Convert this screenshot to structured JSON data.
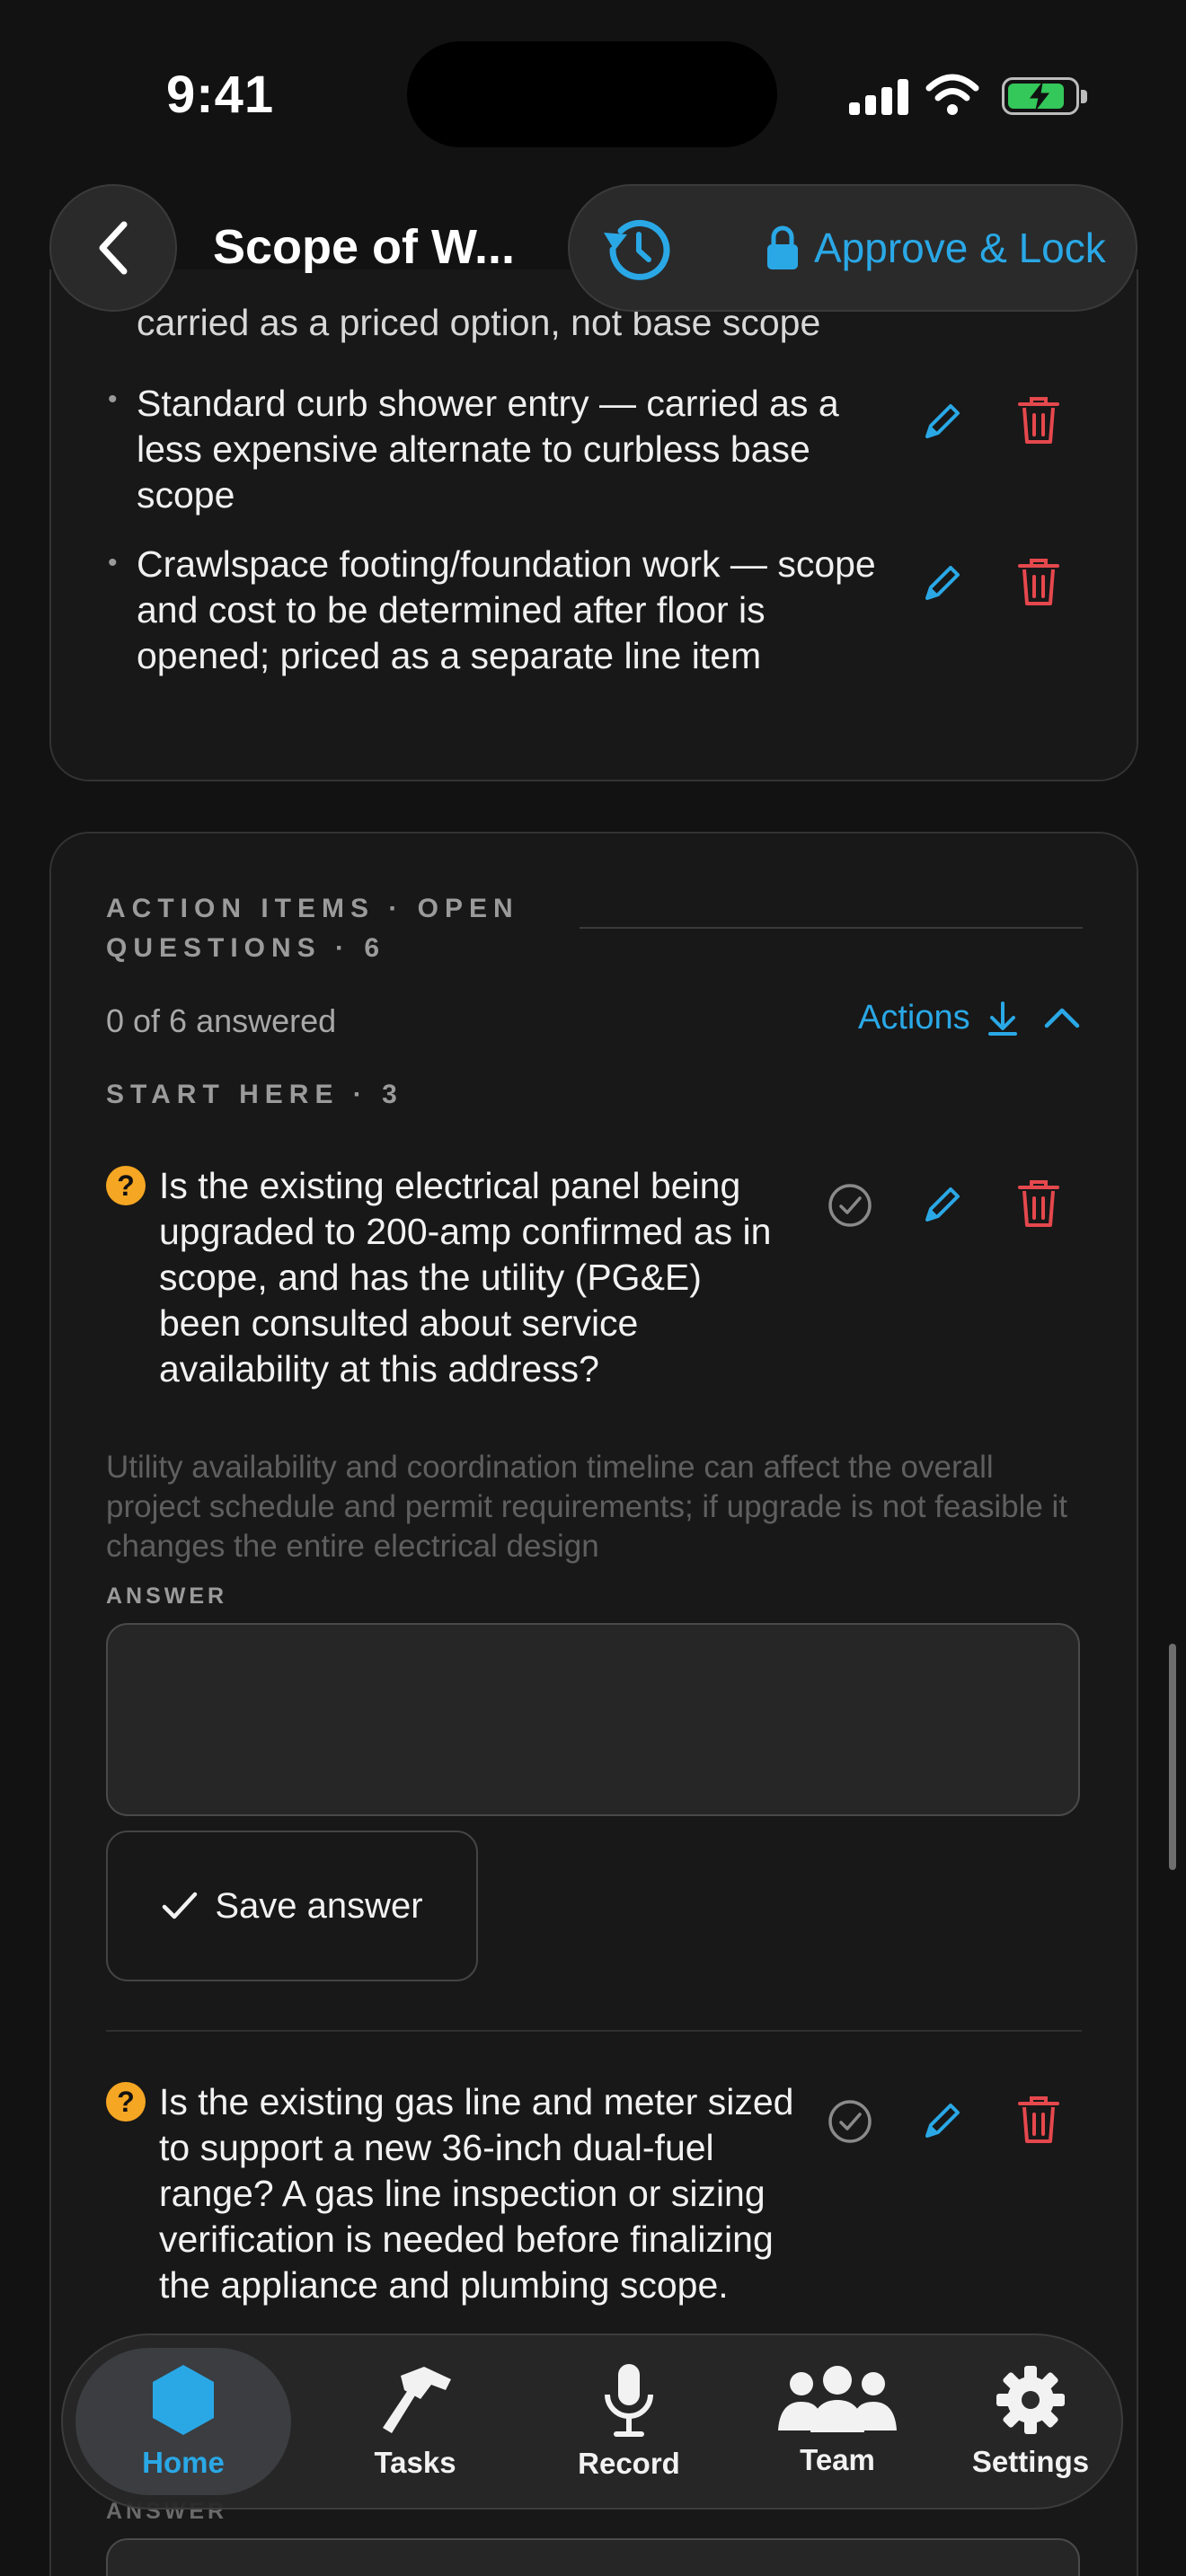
{
  "status_bar": {
    "time": "9:41"
  },
  "header": {
    "title": "Scope of W...",
    "approve_label": "Approve & Lock"
  },
  "scope_card": {
    "clipped_line": "carried as a priced option, not base scope",
    "items": [
      {
        "text": "Standard curb shower entry — carried as a less expensive alternate to curbless base scope"
      },
      {
        "text": "Crawlspace footing/foundation work — scope and cost to be determined after floor is opened; priced as a separate line item"
      }
    ]
  },
  "action_items": {
    "title": "ACTION ITEMS · OPEN QUESTIONS · 6",
    "progress": "0 of 6 answered",
    "actions_label": "Actions",
    "group_label": "START HERE · 3",
    "questions": [
      {
        "icon": "?",
        "text": "Is the existing electrical panel being upgraded to 200-amp confirmed as in scope, and has the utility (PG&E) been consulted about service availability at this address?",
        "note": "Utility availability and coordination timeline can affect the overall project schedule and permit requirements; if upgrade is not feasible it changes the entire electrical design",
        "answer_label": "ANSWER",
        "answer_value": "",
        "save_label": "Save answer"
      },
      {
        "icon": "?",
        "text": "Is the existing gas line and meter sized to support a new 36-inch dual-fuel range? A gas line inspection or sizing verification is needed before finalizing the appliance and plumbing scope.",
        "answer_label": "ANSWER"
      }
    ]
  },
  "tabbar": {
    "tabs": [
      {
        "label": "Home",
        "icon": "hexagon-icon",
        "active": true
      },
      {
        "label": "Tasks",
        "icon": "hammer-icon"
      },
      {
        "label": "Record",
        "icon": "microphone-icon"
      },
      {
        "label": "Team",
        "icon": "people-icon"
      },
      {
        "label": "Settings",
        "icon": "gear-icon"
      }
    ]
  },
  "colors": {
    "accent": "#2aa8e6",
    "danger": "#e5484d",
    "warning": "#f5a623",
    "background": "#121212"
  }
}
